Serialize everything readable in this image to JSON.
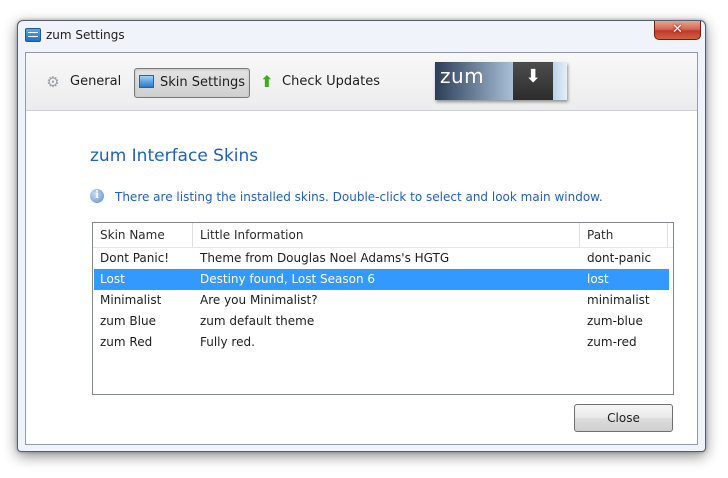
{
  "window": {
    "title": "zum Settings",
    "close_glyph": "✕",
    "icon": "app-icon"
  },
  "tabs": [
    {
      "label": "General",
      "icon": "gear-icon",
      "selected": false
    },
    {
      "label": "Skin Settings",
      "icon": "monitor-icon",
      "selected": true
    },
    {
      "label": "Check Updates",
      "icon": "green-up-arrow-icon",
      "selected": false
    }
  ],
  "banner": {
    "logo_text": "zum",
    "icon": "download-arrow-icon"
  },
  "section": {
    "title": "zum Interface Skins",
    "info": "There are listing the installed skins. Double-click to select and look main window."
  },
  "table": {
    "columns": [
      "Skin Name",
      "Little Information",
      "Path"
    ],
    "rows": [
      {
        "name": "Dont Panic!",
        "info": "Theme from Douglas Noel Adams's HGTG",
        "path": "dont-panic",
        "selected": false
      },
      {
        "name": "Lost",
        "info": "Destiny found, Lost Season 6",
        "path": "lost",
        "selected": true
      },
      {
        "name": "Minimalist",
        "info": "Are you Minimalist?",
        "path": "minimalist",
        "selected": false
      },
      {
        "name": "zum Blue",
        "info": "zum default theme",
        "path": "zum-blue",
        "selected": false
      },
      {
        "name": "zum Red",
        "info": "Fully red.",
        "path": "zum-red",
        "selected": false
      }
    ]
  },
  "buttons": {
    "close": "Close"
  },
  "colors": {
    "accent": "#1f5fbf",
    "selection": "#3399ff",
    "close_button": "#c0392b"
  }
}
